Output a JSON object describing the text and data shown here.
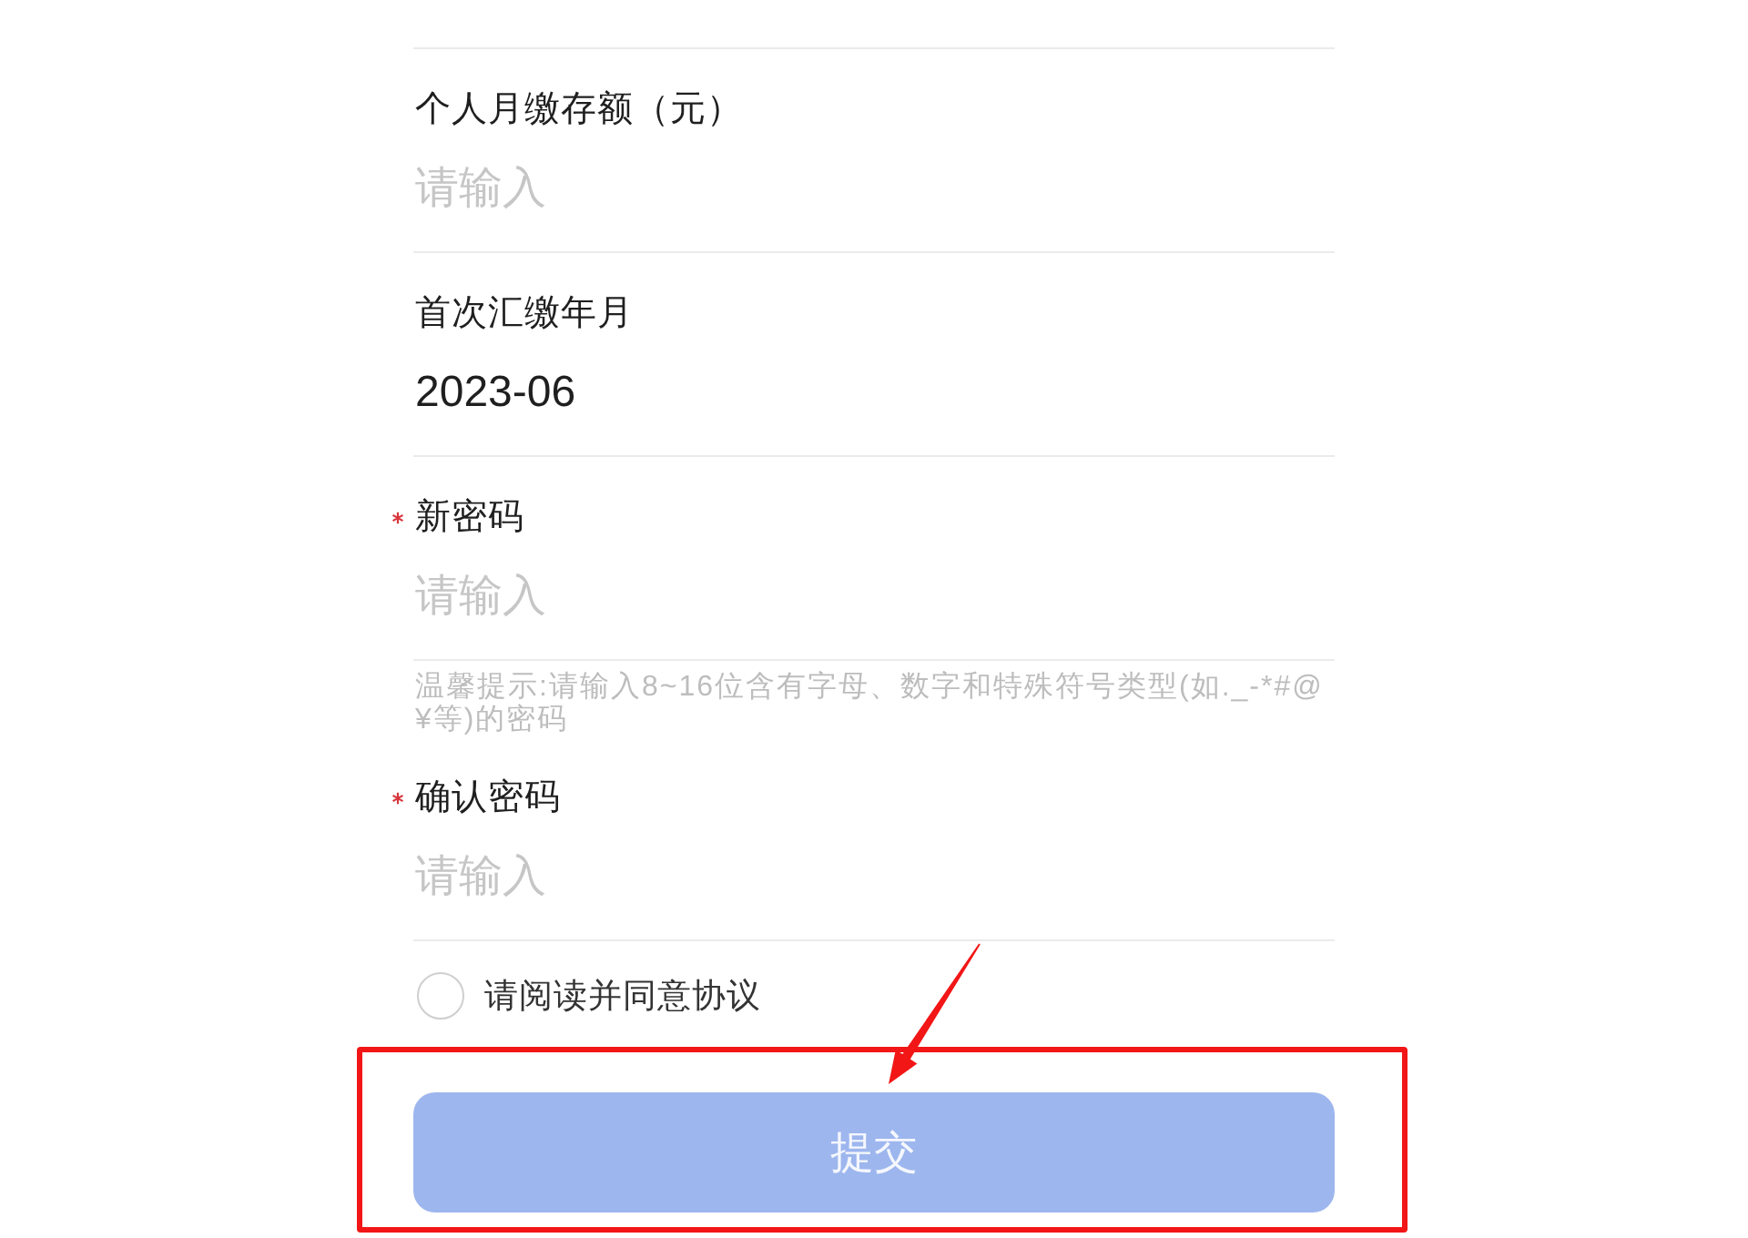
{
  "fields": [
    {
      "label": "个人月缴存额（元）",
      "required": false,
      "placeholder": "请输入"
    },
    {
      "label": "首次汇缴年月",
      "required": false,
      "value": "2023-06"
    },
    {
      "label": "新密码",
      "required": true,
      "placeholder": "请输入",
      "hint": "温馨提示:请输入8~16位含有字母、数字和特殊符号类型(如._-*#@¥等)的密码"
    },
    {
      "label": "确认密码",
      "required": true,
      "placeholder": "请输入"
    }
  ],
  "agreement": {
    "label": "请阅读并同意协议",
    "checked": false
  },
  "submit": {
    "label": "提交",
    "disabled": true,
    "highlighted": true
  }
}
